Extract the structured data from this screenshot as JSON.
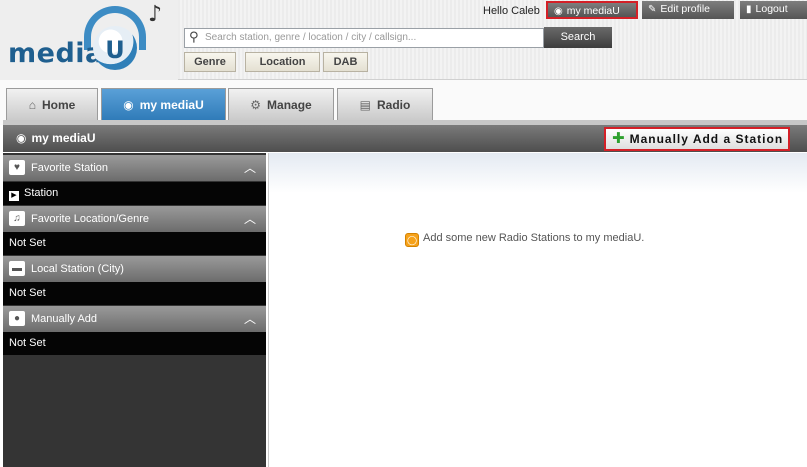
{
  "header": {
    "logo_text": "media",
    "logo_letter": "U",
    "greeting": "Hello Caleb",
    "my_mediau": "my mediaU",
    "edit_profile": "Edit profile",
    "logout": "Logout",
    "search_placeholder": "Search station, genre / location / city / callsign...",
    "search_button": "Search",
    "categories": [
      "Genre",
      "Location",
      "DAB"
    ]
  },
  "tabs": [
    {
      "label": "Home"
    },
    {
      "label": "my mediaU"
    },
    {
      "label": "Manage"
    },
    {
      "label": "Radio"
    }
  ],
  "section": {
    "title": "my mediaU",
    "add_button": "Manually Add a Station"
  },
  "sidebar": {
    "groups": [
      {
        "title": "Favorite Station",
        "item": "Station"
      },
      {
        "title": "Favorite Location/Genre",
        "item": "Not Set"
      },
      {
        "title": "Local Station (City)",
        "item": "Not Set"
      },
      {
        "title": "Manually Add",
        "item": "Not Set"
      }
    ]
  },
  "main": {
    "empty_message": "Add some new Radio Stations to my mediaU."
  },
  "colors": {
    "accent_blue": "#3d8cc4",
    "highlight_red": "#d42027",
    "add_green": "#2ea02e"
  }
}
